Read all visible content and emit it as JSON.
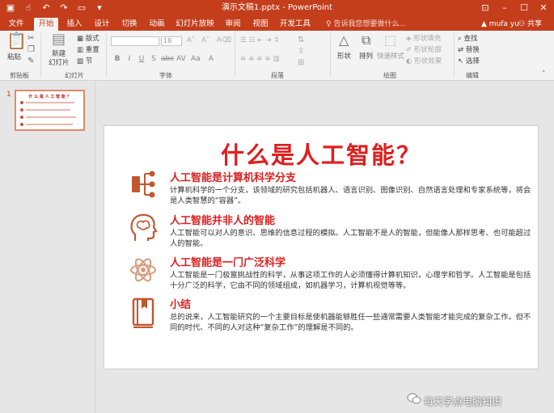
{
  "window": {
    "title": "演示文稿1.pptx - PowerPoint"
  },
  "quick_access": {
    "icons": [
      "save-icon",
      "touch-mode-icon",
      "undo-icon",
      "redo-icon",
      "start-from-beginning-icon",
      "customize-qat-icon"
    ]
  },
  "tabs": [
    {
      "label": "文件"
    },
    {
      "label": "开始"
    },
    {
      "label": "插入"
    },
    {
      "label": "设计"
    },
    {
      "label": "切换"
    },
    {
      "label": "动画"
    },
    {
      "label": "幻灯片放映"
    },
    {
      "label": "审阅"
    },
    {
      "label": "视图"
    },
    {
      "label": "开发工具"
    }
  ],
  "tell_me": "告诉我您想要做什么...",
  "user_name": "mufa yu",
  "share_label": "共享",
  "ribbon": {
    "clipboard": {
      "paste": "粘贴",
      "group": "剪贴板"
    },
    "slides": {
      "new_slide": "新建\n幻灯片",
      "layout": "版式",
      "reset": "重置",
      "section": "节",
      "group": "幻灯片"
    },
    "font": {
      "group": "字体",
      "size": "18"
    },
    "paragraph": {
      "group": "段落"
    },
    "drawing": {
      "shapes": "形状",
      "arrange": "排列",
      "quick_styles": "快速样式",
      "fill": "形状填充",
      "outline": "形状轮廓",
      "effects": "形状效果",
      "group": "绘图"
    },
    "editing": {
      "find": "查找",
      "replace": "替换",
      "select": "选择",
      "group": "编辑"
    }
  },
  "thumbnail": {
    "number": "1",
    "title": "什 么 是 人 工 智 能 ？"
  },
  "slide": {
    "title": "什么是人工智能？",
    "items": [
      {
        "icon": "hierarchy-icon",
        "heading": "人工智能是计算机科学分支",
        "body": "计算机科学的一个分支，该领域的研究包括机器人、语言识别、图像识别、自然语言处理和专家系统等，将会是人类智慧的“容器”。"
      },
      {
        "icon": "brain-head-icon",
        "heading": "人工智能并非人的智能",
        "body": "人工智能可以对人的意识、思维的信息过程的模拟。人工智能不是人的智能，但能像人那样思考、也可能超过人的智能。"
      },
      {
        "icon": "atom-icon",
        "heading": "人工智能是一门广泛科学",
        "body": "人工智能是一门极富挑战性的科学，从事这项工作的人必须懂得计算机知识，心理学和哲学。人工智能是包括十分广泛的科学，它由不同的领域组成，如机器学习，计算机视觉等等。"
      },
      {
        "icon": "book-icon",
        "heading": "小结",
        "body": "总的说来，人工智能研究的一个主要目标是使机器能够胜任一些通常需要人类智能才能完成的复杂工作。但不同的时代、不同的人对这种“复杂工作”的理解是不同的。"
      }
    ]
  },
  "watermark": "每天学点电脑知识",
  "colors": {
    "accent": "#c43e1c",
    "title_red": "#e01e1e",
    "icon_orange": "#c2572e"
  }
}
